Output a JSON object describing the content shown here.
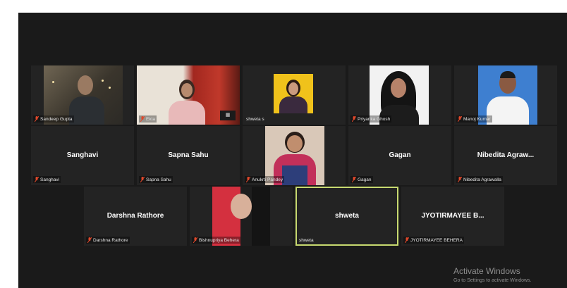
{
  "participants": [
    {
      "id": "sandeep",
      "label": "Sandeep Gupta",
      "muted": true,
      "video": true
    },
    {
      "id": "ekta",
      "label": "Ekta",
      "muted": true,
      "video": true
    },
    {
      "id": "shweta_s",
      "label": "shweta s",
      "muted": false,
      "video": true
    },
    {
      "id": "priyanka",
      "label": "Priyanka Ghosh",
      "muted": true,
      "video": true
    },
    {
      "id": "manoj",
      "label": "Manoj Kumar",
      "muted": true,
      "video": true
    },
    {
      "id": "sanghavi",
      "label": "Sanghavi",
      "display": "Sanghavi",
      "muted": true,
      "video": false
    },
    {
      "id": "sapna",
      "label": "Sapna Sahu",
      "display": "Sapna Sahu",
      "muted": true,
      "video": false
    },
    {
      "id": "anukrti",
      "label": "Anukrti Pandey",
      "muted": true,
      "video": true
    },
    {
      "id": "gagan",
      "label": "Gagan",
      "display": "Gagan",
      "muted": true,
      "video": false
    },
    {
      "id": "nibedita",
      "label": "Nibedita Agrawalla",
      "display": "Nibedita Agraw...",
      "muted": true,
      "video": false
    },
    {
      "id": "darshna",
      "label": "Darshna Rathore",
      "display": "Darshna Rathore",
      "muted": true,
      "video": false
    },
    {
      "id": "bishnupriya",
      "label": "Bishnupriya Behera",
      "muted": true,
      "video": true
    },
    {
      "id": "shweta",
      "label": "shweta",
      "display": "shweta",
      "muted": false,
      "video": false,
      "active_speaker": true
    },
    {
      "id": "jyotirmayee",
      "label": "JYOTIRMAYEE BEHERA",
      "display": "JYOTIRMAYEE  B...",
      "muted": true,
      "video": false
    }
  ],
  "watermark": {
    "title": "Activate Windows",
    "subtitle": "Go to Settings to activate Windows."
  },
  "colors": {
    "stage": "#1a1a1a",
    "tile": "#232323",
    "mic_muted": "#e0482b",
    "active_border": "#c7d970"
  }
}
